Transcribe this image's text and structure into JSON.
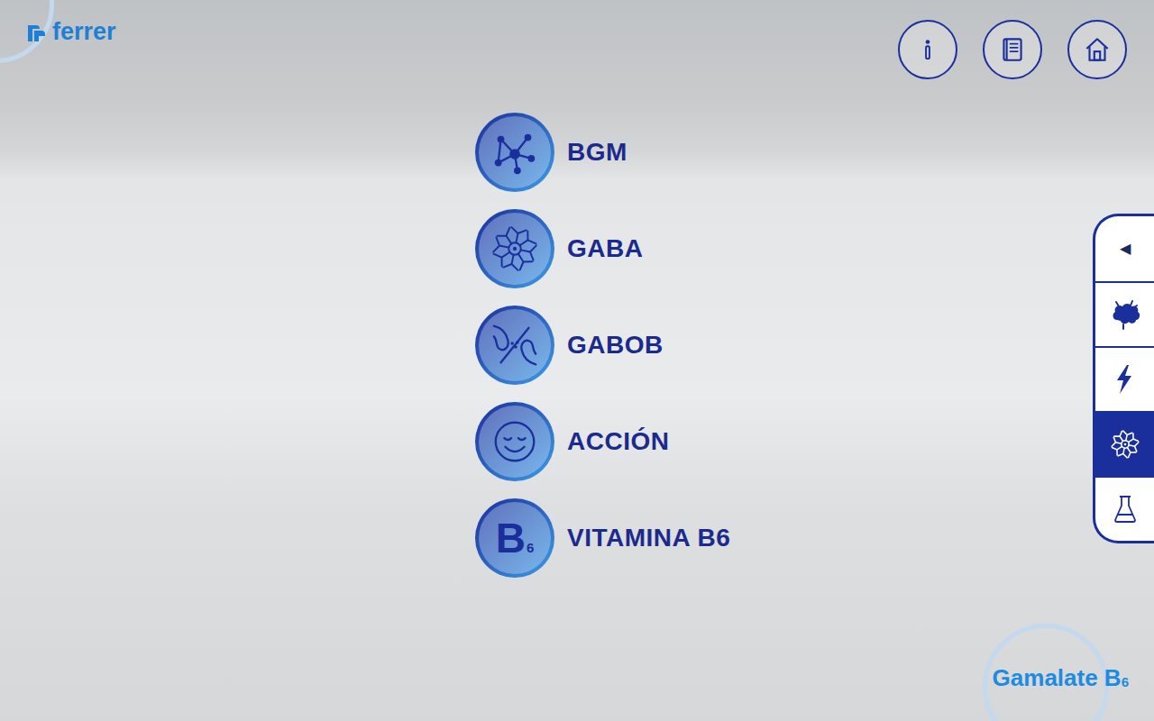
{
  "brand": {
    "logo": "ferrer"
  },
  "menu": [
    {
      "label": "BGM"
    },
    {
      "label": "GABA"
    },
    {
      "label": "GABOB"
    },
    {
      "label": "ACCIÓN"
    },
    {
      "label": "VITAMINA B6",
      "icon_text": "B",
      "icon_sub": "6"
    }
  ],
  "side_panel": {
    "toggle": "◀",
    "tabs": [
      {
        "selected": false
      },
      {
        "selected": false
      },
      {
        "selected": true
      },
      {
        "selected": false
      }
    ]
  },
  "product": {
    "name": "Gamalate B",
    "sub": "6"
  }
}
